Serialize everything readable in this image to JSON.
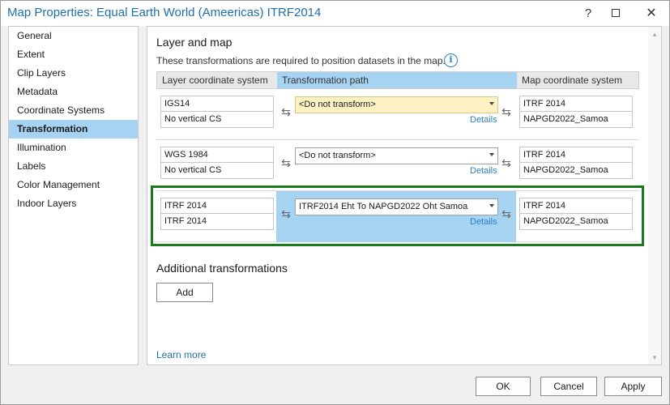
{
  "window": {
    "title": "Map Properties: Equal Earth World (Ameericas) ITRF2014",
    "help_glyph": "?",
    "close_glyph": "✕"
  },
  "sidebar": {
    "items": [
      {
        "label": "General"
      },
      {
        "label": "Extent"
      },
      {
        "label": "Clip Layers"
      },
      {
        "label": "Metadata"
      },
      {
        "label": "Coordinate Systems"
      },
      {
        "label": "Transformation",
        "selected": true
      },
      {
        "label": "Illumination"
      },
      {
        "label": "Labels"
      },
      {
        "label": "Color Management"
      },
      {
        "label": "Indoor Layers"
      }
    ]
  },
  "main": {
    "section_title": "Layer and map",
    "description": "These transformations are required to position datasets in the map.",
    "info_glyph": "i",
    "columns": {
      "layer": "Layer coordinate system",
      "path": "Transformation path",
      "map": "Map coordinate system"
    },
    "rows": [
      {
        "layer_cs": "IGS14",
        "layer_vcs": "No vertical CS",
        "transformation": "<Do not transform>",
        "details": "Details",
        "map_cs": "ITRF 2014",
        "map_vcs": "NAPGD2022_Samoa",
        "state": "warning"
      },
      {
        "layer_cs": "WGS 1984",
        "layer_vcs": "No vertical CS",
        "transformation": "<Do not transform>",
        "details": "Details",
        "map_cs": "ITRF 2014",
        "map_vcs": "NAPGD2022_Samoa",
        "state": "normal"
      },
      {
        "layer_cs": "ITRF 2014",
        "layer_vcs": "ITRF 2014",
        "transformation": "ITRF2014 Eht To NAPGD2022 Oht Samoa",
        "details": "Details",
        "map_cs": "ITRF 2014",
        "map_vcs": "NAPGD2022_Samoa",
        "state": "selected"
      }
    ],
    "swap_glyph": "⇆",
    "additional_title": "Additional transformations",
    "add_label": "Add",
    "learn_more": "Learn more"
  },
  "footer": {
    "ok": "OK",
    "cancel": "Cancel",
    "apply": "Apply"
  },
  "colors": {
    "accent": "#1f6fa8",
    "selection": "#a6d3f2",
    "warning_fill": "#fcf2c4",
    "highlight_frame": "#1b7a1b"
  }
}
